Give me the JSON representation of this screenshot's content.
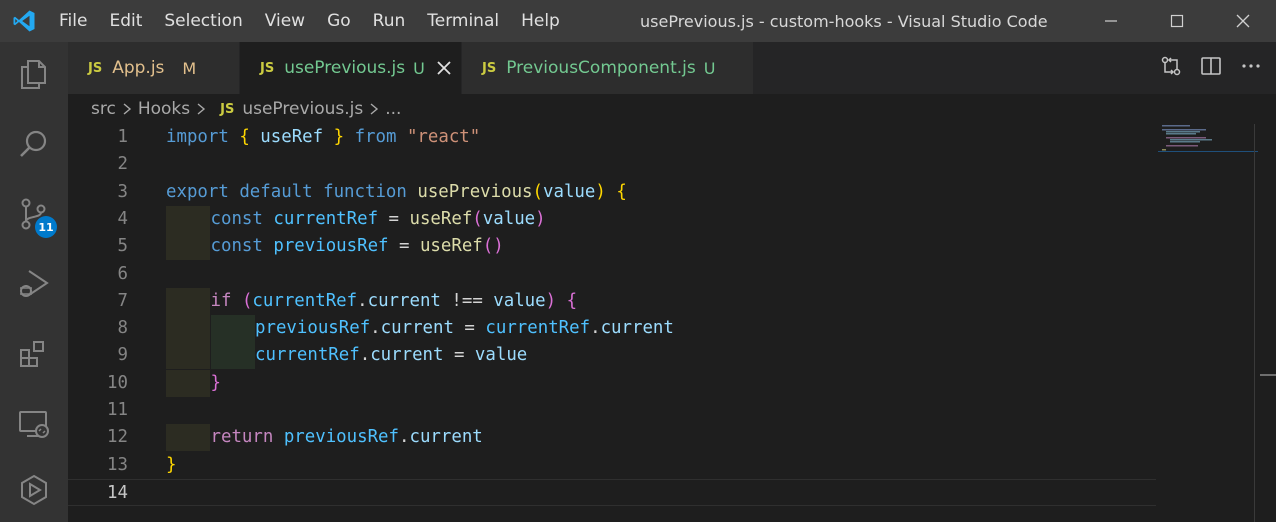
{
  "app": {
    "window_title": "usePrevious.js - custom-hooks - Visual Studio Code",
    "menu": [
      "File",
      "Edit",
      "Selection",
      "View",
      "Go",
      "Run",
      "Terminal",
      "Help"
    ]
  },
  "activity_bar": {
    "items": [
      "explorer-icon",
      "search-icon",
      "source-control-icon",
      "run-debug-icon",
      "extensions-icon",
      "remote-explorer-icon",
      "live-share-icon"
    ],
    "source_control_badge": "11"
  },
  "tabs": [
    {
      "icon": "JS",
      "label": "App.js",
      "status": "M",
      "label_color": "#e2c08d",
      "status_color": "#e2c08d",
      "active": false
    },
    {
      "icon": "JS",
      "label": "usePrevious.js",
      "status": "U",
      "label_color": "#73c991",
      "status_color": "#73c991",
      "active": true
    },
    {
      "icon": "JS",
      "label": "PreviousComponent.js",
      "status": "U",
      "label_color": "#73c991",
      "status_color": "#73c991",
      "active": false
    }
  ],
  "breadcrumb": {
    "parts": [
      "src",
      "Hooks"
    ],
    "file_icon": "JS",
    "file": "usePrevious.js",
    "ellipsis": "..."
  },
  "editor": {
    "current_line": 14,
    "lines": [
      {
        "n": "1",
        "indent": 0,
        "tokens": [
          [
            "kw",
            "import"
          ],
          [
            "plain",
            " "
          ],
          [
            "br1",
            "{"
          ],
          [
            "plain",
            " "
          ],
          [
            "var",
            "useRef"
          ],
          [
            "plain",
            " "
          ],
          [
            "br1",
            "}"
          ],
          [
            "plain",
            " "
          ],
          [
            "kw",
            "from"
          ],
          [
            "plain",
            " "
          ],
          [
            "str",
            "\"react\""
          ]
        ]
      },
      {
        "n": "2",
        "indent": 0,
        "tokens": []
      },
      {
        "n": "3",
        "indent": 0,
        "tokens": [
          [
            "kw",
            "export"
          ],
          [
            "plain",
            " "
          ],
          [
            "kw",
            "default"
          ],
          [
            "plain",
            " "
          ],
          [
            "kw",
            "function"
          ],
          [
            "plain",
            " "
          ],
          [
            "fn",
            "usePrevious"
          ],
          [
            "br1",
            "("
          ],
          [
            "var",
            "value"
          ],
          [
            "br1",
            ")"
          ],
          [
            "plain",
            " "
          ],
          [
            "br1",
            "{"
          ]
        ]
      },
      {
        "n": "4",
        "indent": 1,
        "tokens": [
          [
            "kw",
            "const"
          ],
          [
            "plain",
            " "
          ],
          [
            "const",
            "currentRef"
          ],
          [
            "plain",
            " = "
          ],
          [
            "fn",
            "useRef"
          ],
          [
            "br2",
            "("
          ],
          [
            "var",
            "value"
          ],
          [
            "br2",
            ")"
          ]
        ]
      },
      {
        "n": "5",
        "indent": 1,
        "tokens": [
          [
            "kw",
            "const"
          ],
          [
            "plain",
            " "
          ],
          [
            "const",
            "previousRef"
          ],
          [
            "plain",
            " = "
          ],
          [
            "fn",
            "useRef"
          ],
          [
            "br2",
            "()"
          ]
        ]
      },
      {
        "n": "6",
        "indent": 0,
        "tokens": []
      },
      {
        "n": "7",
        "indent": 1,
        "tokens": [
          [
            "ctrl",
            "if"
          ],
          [
            "plain",
            " "
          ],
          [
            "br2",
            "("
          ],
          [
            "const",
            "currentRef"
          ],
          [
            "plain",
            "."
          ],
          [
            "var",
            "current"
          ],
          [
            "plain",
            " !== "
          ],
          [
            "var",
            "value"
          ],
          [
            "br2",
            ")"
          ],
          [
            "plain",
            " "
          ],
          [
            "br2",
            "{"
          ]
        ]
      },
      {
        "n": "8",
        "indent": 2,
        "tokens": [
          [
            "const",
            "previousRef"
          ],
          [
            "plain",
            "."
          ],
          [
            "var",
            "current"
          ],
          [
            "plain",
            " = "
          ],
          [
            "const",
            "currentRef"
          ],
          [
            "plain",
            "."
          ],
          [
            "var",
            "current"
          ]
        ]
      },
      {
        "n": "9",
        "indent": 2,
        "tokens": [
          [
            "const",
            "currentRef"
          ],
          [
            "plain",
            "."
          ],
          [
            "var",
            "current"
          ],
          [
            "plain",
            " = "
          ],
          [
            "var",
            "value"
          ]
        ]
      },
      {
        "n": "10",
        "indent": 1,
        "tokens": [
          [
            "br2",
            "}"
          ]
        ]
      },
      {
        "n": "11",
        "indent": 0,
        "tokens": []
      },
      {
        "n": "12",
        "indent": 1,
        "tokens": [
          [
            "ctrl",
            "return"
          ],
          [
            "plain",
            " "
          ],
          [
            "const",
            "previousRef"
          ],
          [
            "plain",
            "."
          ],
          [
            "var",
            "current"
          ]
        ]
      },
      {
        "n": "13",
        "indent": 0,
        "tokens": [
          [
            "br1",
            "}"
          ]
        ]
      },
      {
        "n": "14",
        "indent": 0,
        "tokens": []
      }
    ]
  }
}
